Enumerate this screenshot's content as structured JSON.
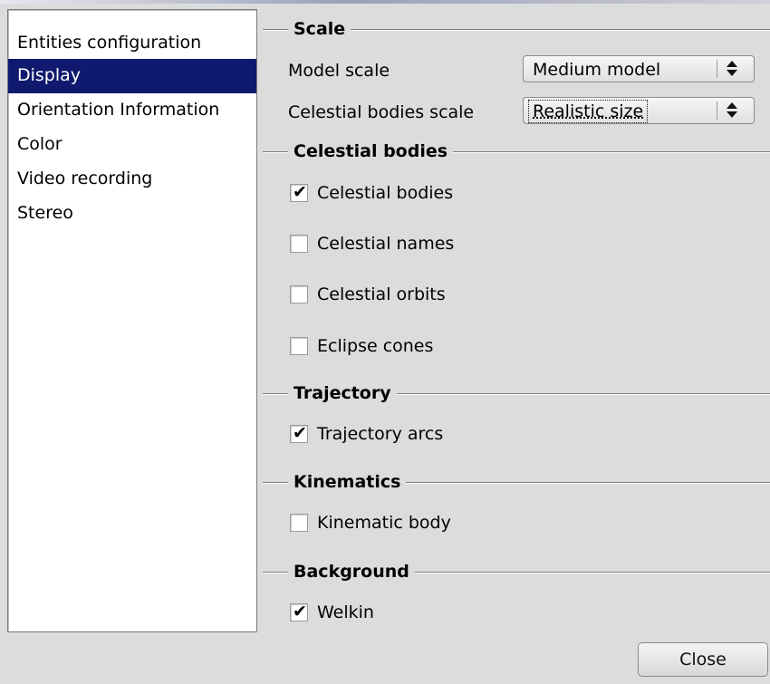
{
  "categories": [
    {
      "label": "Entities configuration",
      "selected": false
    },
    {
      "label": "Display",
      "selected": true
    },
    {
      "label": "Orientation Information",
      "selected": false
    },
    {
      "label": "Color",
      "selected": false
    },
    {
      "label": "Video recording",
      "selected": false
    },
    {
      "label": "Stereo",
      "selected": false
    }
  ],
  "scale": {
    "title": "Scale",
    "model_scale_label": "Model scale",
    "model_scale_value": "Medium model",
    "celestial_scale_label": "Celestial bodies scale",
    "celestial_scale_value": "Realistic size"
  },
  "celestial": {
    "title": "Celestial bodies",
    "options": [
      {
        "label": "Celestial bodies",
        "checked": true
      },
      {
        "label": "Celestial names",
        "checked": false
      },
      {
        "label": "Celestial orbits",
        "checked": false
      },
      {
        "label": "Eclipse cones",
        "checked": false
      }
    ]
  },
  "trajectory": {
    "title": "Trajectory",
    "options": [
      {
        "label": "Trajectory arcs",
        "checked": true
      }
    ]
  },
  "kinematics": {
    "title": "Kinematics",
    "options": [
      {
        "label": "Kinematic body",
        "checked": false
      }
    ]
  },
  "background": {
    "title": "Background",
    "options": [
      {
        "label": "Welkin",
        "checked": true
      }
    ]
  },
  "footer": {
    "close_label": "Close"
  },
  "colors": {
    "selection": "#0f1a6e",
    "panel_bg": "#dcdcdc"
  }
}
